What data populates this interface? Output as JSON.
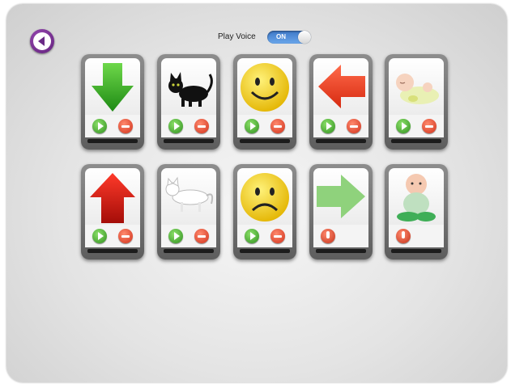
{
  "header": {
    "play_voice_label": "Play Voice",
    "toggle_label": "ON",
    "toggle_state": "on",
    "toggle_color": "#3d78c8"
  },
  "back_button": {
    "icon": "back-arrow-icon",
    "color": "#6a2a86"
  },
  "cards": [
    {
      "id": "down-arrow",
      "image": "green-down-arrow-icon",
      "controls": [
        "play",
        "remove"
      ]
    },
    {
      "id": "black-cat",
      "image": "black-cat-icon",
      "controls": [
        "play",
        "remove"
      ]
    },
    {
      "id": "happy-face",
      "image": "smiley-face-icon",
      "controls": [
        "play",
        "remove"
      ]
    },
    {
      "id": "left-arrow",
      "image": "red-left-arrow-icon",
      "controls": [
        "play",
        "remove"
      ]
    },
    {
      "id": "sleeping-baby",
      "image": "sleeping-baby-icon",
      "controls": [
        "play",
        "remove"
      ]
    },
    {
      "id": "up-arrow",
      "image": "red-up-arrow-icon",
      "controls": [
        "play",
        "remove"
      ]
    },
    {
      "id": "white-cat",
      "image": "white-cat-icon",
      "controls": [
        "play",
        "remove"
      ]
    },
    {
      "id": "sad-face",
      "image": "sad-face-icon",
      "controls": [
        "play",
        "remove"
      ]
    },
    {
      "id": "right-arrow",
      "image": "green-right-arrow-icon",
      "controls": [
        "record"
      ]
    },
    {
      "id": "sitting-baby",
      "image": "sitting-baby-icon",
      "controls": [
        "record"
      ]
    }
  ]
}
